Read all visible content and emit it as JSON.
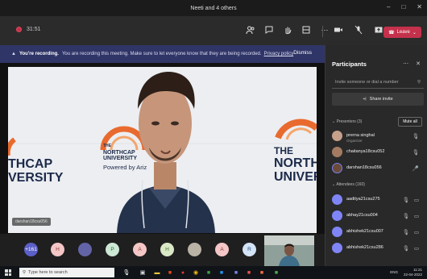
{
  "window": {
    "title": "Neeti and 4 others",
    "minimize": "–",
    "close": "✕"
  },
  "toolbar": {
    "elapsed": "31:51",
    "leave_label": "Leave"
  },
  "banner": {
    "heading": "You're recording.",
    "message": "You are recording this meeting. Make sure to let everyone know that they are being recorded.",
    "privacy_link": "Privacy policy",
    "dismiss_label": "Dismiss"
  },
  "video": {
    "name_tag": "darshan18csu056",
    "logo_left_line1": "THCAP",
    "logo_left_line2": "VERSITY",
    "logo_center_the": "THE",
    "logo_center_line1": "NORTHCAP",
    "logo_center_line2": "UNIVERSITY",
    "logo_center_powered": "Powered by Ariz",
    "logo_right_the": "THE",
    "logo_right_line1": "NORTH",
    "logo_right_line2": "UNIVER"
  },
  "avatar_row": [
    {
      "label": "+161",
      "color": "#5b5fc7",
      "text_color": "#ffffff"
    },
    {
      "label": "H",
      "color": "#f5c6c6",
      "text_color": "#8a3b3b"
    },
    {
      "label": "",
      "color": "#6264a7",
      "text_color": "#ffffff"
    },
    {
      "label": "P",
      "color": "#cde8d5",
      "text_color": "#2e6b3e"
    },
    {
      "label": "A",
      "color": "#f5c6c6",
      "text_color": "#8a3b3b"
    },
    {
      "label": "H",
      "color": "#d9e8c6",
      "text_color": "#4a6b2e"
    },
    {
      "label": "",
      "color": "#b9b2a5",
      "text_color": "#333333"
    },
    {
      "label": "A",
      "color": "#f5c6c6",
      "text_color": "#8a3b3b"
    },
    {
      "label": "R",
      "color": "#d4e4f7",
      "text_color": "#2b4f7a"
    }
  ],
  "panel": {
    "title": "Participants",
    "search_placeholder": "Invite someone or dial a number",
    "share_invite": "Share invite",
    "presenters_header": "Presenters (3)",
    "mute_all": "Mute all",
    "attendees_header": "Attendees (160)",
    "presenters": [
      {
        "name": "prerna singhal",
        "role": "Organizer"
      },
      {
        "name": "chaitanya18csu052",
        "role": ""
      },
      {
        "name": "darshan18csu056",
        "role": ""
      }
    ],
    "attendees": [
      {
        "name": "aaditya21csu275"
      },
      {
        "name": "abhay21csu004"
      },
      {
        "name": "abhishek21csu007"
      },
      {
        "name": "abhishek21csu286"
      }
    ]
  },
  "taskbar": {
    "search_placeholder": "Type here to search",
    "time": "11:21",
    "date": "22-04-2022",
    "lang": "ENG"
  }
}
